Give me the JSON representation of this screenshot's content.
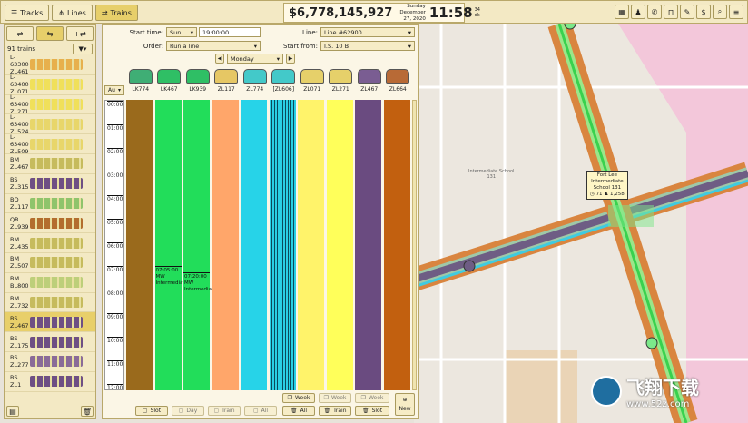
{
  "tabs": [
    {
      "label": "Tracks",
      "icon": "track-icon"
    },
    {
      "label": "Lines",
      "icon": "line-icon"
    },
    {
      "label": "Trains",
      "icon": "train-icon"
    }
  ],
  "money": "$6,778,145,927",
  "date": {
    "day": "Sunday",
    "full": "December 27, 2020"
  },
  "time": "11:58",
  "seconds": {
    "s1": "34",
    "s2": "dk"
  },
  "count": "91 trains",
  "trains": [
    {
      "op": "L-63300",
      "code": "ZL461",
      "color": "#e7b04c"
    },
    {
      "op": "L-63400",
      "code": "ZL071",
      "color": "#f0e05a"
    },
    {
      "op": "L-63400",
      "code": "ZL271",
      "color": "#f0e05a"
    },
    {
      "op": "L-63400",
      "code": "ZL524",
      "color": "#e8d66a"
    },
    {
      "op": "L-63400",
      "code": "ZL509",
      "color": "#e8d66a"
    },
    {
      "op": "BM",
      "code": "ZL467",
      "color": "#c6bb5d"
    },
    {
      "op": "BS",
      "code": "ZL315",
      "color": "#6e4f84"
    },
    {
      "op": "BQ",
      "code": "ZL117",
      "color": "#8fc46b"
    },
    {
      "op": "QR",
      "code": "ZL939",
      "color": "#b36d2e"
    },
    {
      "op": "BM",
      "code": "ZL435",
      "color": "#c6bb5d"
    },
    {
      "op": "BM",
      "code": "ZL507",
      "color": "#c6bb5d"
    },
    {
      "op": "BM",
      "code": "BL800",
      "color": "#bdcf7a"
    },
    {
      "op": "BM",
      "code": "ZL732",
      "color": "#c6bb5d"
    },
    {
      "op": "BS",
      "code": "ZL467",
      "color": "#6e4f84"
    },
    {
      "op": "BS",
      "code": "ZL175",
      "color": "#6e4f84"
    },
    {
      "op": "BS",
      "code": "ZL277",
      "color": "#8a6b98"
    },
    {
      "op": "BS",
      "code": "ZL1",
      "color": "#6e4f84"
    }
  ],
  "timetable": {
    "start_time_label": "Start time:",
    "start_day": "Sun",
    "start_time": "19:00:00",
    "line_label": "Line:",
    "line": "Line #62900",
    "order_label": "Order:",
    "order": "Run a line",
    "start_from_label": "Start from:",
    "start_from": "I.S. 10 B",
    "day": "Monday",
    "auto": "Au",
    "columns": [
      {
        "code": "LK774",
        "color": "#9a6a1c",
        "car": "#3fae75"
      },
      {
        "code": "LK467",
        "color": "#22dd5a",
        "car": "#2fbf65"
      },
      {
        "code": "LK939",
        "color": "#22dd5a",
        "car": "#2fbf65"
      },
      {
        "code": "ZL117",
        "color": "#ffa66a",
        "car": "#e6c764"
      },
      {
        "code": "ZL774",
        "color": "#27d3e8",
        "car": "#43c9c9"
      },
      {
        "code": "[ZL606]",
        "color": "#2ad0e4",
        "car": "#43c9c9"
      },
      {
        "code": "ZL071",
        "color": "#fff36a",
        "car": "#e6d06a"
      },
      {
        "code": "ZL271",
        "color": "#ffff5a",
        "car": "#e6d06a"
      },
      {
        "code": "ZL467",
        "color": "#6a4b80",
        "car": "#7a5d92"
      },
      {
        "code": "ZL664",
        "color": "#c2600f",
        "car": "#b86a36"
      }
    ],
    "ticks": [
      "00:00",
      "01:00",
      "02:00",
      "03:00",
      "04:00",
      "05:00",
      "06:00",
      "07:00",
      "08:00",
      "09:00",
      "10:00",
      "11:00",
      "12:00"
    ],
    "slots": [
      {
        "time": "07:05:00",
        "line1": "MW",
        "line2": "Intermediat"
      },
      {
        "time": "07:20:00",
        "line1": "MW",
        "line2": "Intermediat"
      }
    ],
    "foot": {
      "week1": "Week",
      "week2": "Week",
      "week3": "Week",
      "all1": "All",
      "train1": "Train",
      "slot1": "Slot",
      "slot2": "Slot",
      "day": "Day",
      "train2": "Train",
      "all2": "All",
      "new": "New"
    }
  },
  "map": {
    "label1": "Intermediate School",
    "label1b": "131",
    "station": {
      "line1": "Fort Lee",
      "line2": "Intermediate",
      "line3": "School 131",
      "stat1": "71",
      "stat2": "1,258"
    }
  },
  "watermark": {
    "brand": "飞翔下载",
    "site": "www.52z.com"
  }
}
